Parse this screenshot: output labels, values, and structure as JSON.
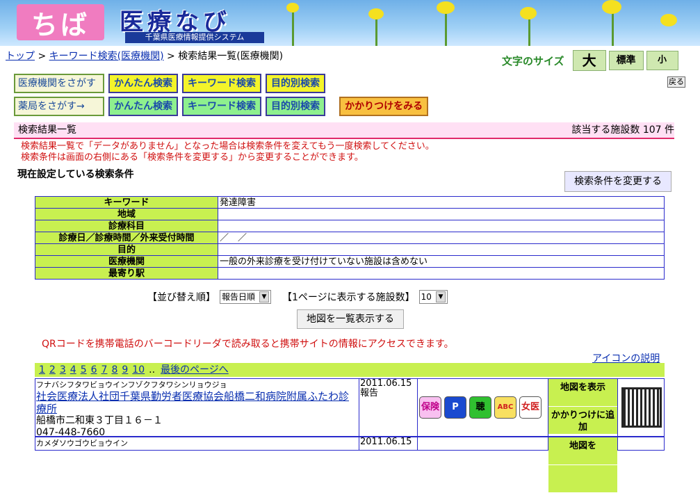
{
  "header": {
    "logo_left": "ちば",
    "logo_right": "医療なび",
    "subtitle": "千葉県医療情報提供システム"
  },
  "breadcrumb": {
    "top": "トップ",
    "keyword": "キーワード検索(医療機関)",
    "current": "検索結果一覧(医療機関)",
    "sep": ">"
  },
  "fontsize": {
    "label": "文字のサイズ",
    "large": "大",
    "normal": "標準",
    "small": "小"
  },
  "back_label": "戻る",
  "nav": {
    "row1": {
      "label": "医療機関をさがす→",
      "easy": "かんたん検索",
      "keyword": "キーワード検索",
      "purpose": "目的別検索"
    },
    "row2": {
      "label": "薬局をさがす→",
      "easy": "かんたん検索",
      "keyword": "キーワード検索",
      "purpose": "目的別検索",
      "family": "かかりつけをみる"
    }
  },
  "result": {
    "title": "検索結果一覧",
    "count": "該当する施設数 107 件"
  },
  "notice": {
    "line1": "検索結果一覧で「データがありません」となった場合は検索条件を変えてもう一度検索してください。",
    "line2": "検索条件は画面の右側にある「検索条件を変更する」から変更することができます。"
  },
  "conditions": {
    "title": "現在設定している検索条件",
    "change_button": "検索条件を変更する",
    "rows": [
      {
        "k": "キーワード",
        "v": "発達障害"
      },
      {
        "k": "地域",
        "v": ""
      },
      {
        "k": "診療科目",
        "v": ""
      },
      {
        "k": "診療日／診療時間／外来受付時間",
        "v": "／　／"
      },
      {
        "k": "目的",
        "v": ""
      },
      {
        "k": "医療機関",
        "v": "一般の外来診療を受け付けていない施設は含めない"
      },
      {
        "k": "最寄り駅",
        "v": ""
      }
    ]
  },
  "sort": {
    "label": "【並び替え順】",
    "value": "報告日順",
    "per_page_label": "【1ページに表示する施設数】",
    "per_page_value": "10"
  },
  "map_all_button": "地図を一覧表示する",
  "qr_note": "QRコードを携帯電話のバーコードリーダで読み取ると携帯サイトの情報にアクセスできます。",
  "icon_help": "アイコンの説明",
  "pager": {
    "pages": [
      "1",
      "2",
      "3",
      "4",
      "5",
      "6",
      "7",
      "8",
      "9",
      "10"
    ],
    "dots": "..",
    "last": "最後のページへ"
  },
  "facilities": [
    {
      "kana": "フナバシフタワビョウインフゾクフタワシンリョウジョ",
      "name": "社会医療法人社団千葉県勤労者医療協会船橋二和病院附属ふたわ診療所",
      "address": "船橋市二和東３丁目１６－１",
      "phone": "047-448-7660",
      "date": "2011.06.15",
      "status": "報告",
      "icons": [
        "保険",
        "P",
        "聴",
        "ABC",
        "女医"
      ],
      "map": "地図を表示",
      "fav": "かかりつけに追加"
    },
    {
      "kana": "カメダソウゴウビョウイン",
      "name": "",
      "address": "",
      "phone": "",
      "date": "2011.06.15",
      "status": "",
      "icons": [],
      "map": "地図を",
      "fav": ""
    }
  ],
  "colors": {
    "accent_green": "#c8f050",
    "link": "#0a2fb0",
    "notice_red": "#d01010",
    "result_pink": "#ffe0f4"
  }
}
